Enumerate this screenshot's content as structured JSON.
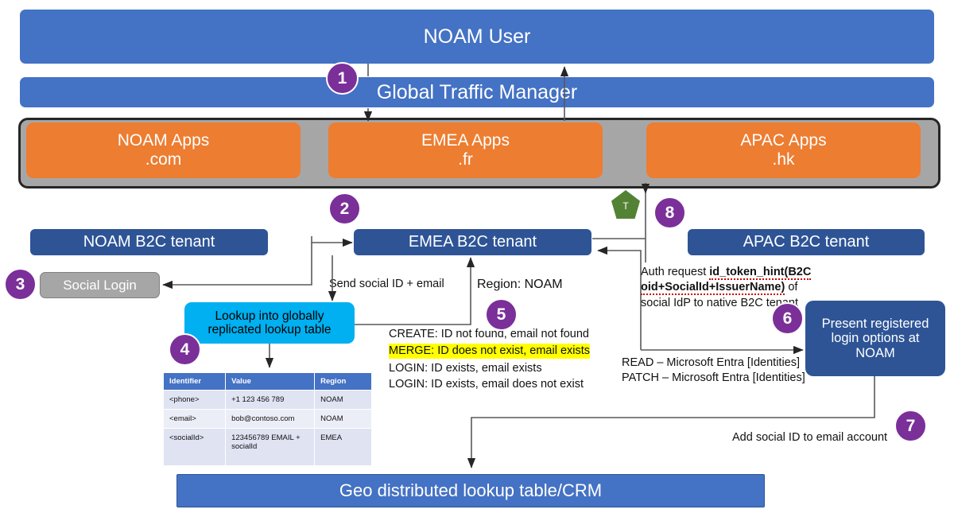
{
  "top": {
    "user": "NOAM User",
    "gtm": "Global Traffic Manager",
    "apps": [
      {
        "name": "NOAM Apps",
        "tld": ".com"
      },
      {
        "name": "EMEA Apps",
        "tld": ".fr"
      },
      {
        "name": "APAC Apps",
        "tld": ".hk"
      }
    ]
  },
  "tenants": {
    "noam": "NOAM B2C tenant",
    "emea": "EMEA B2C tenant",
    "apac": "APAC B2C tenant"
  },
  "nodes": {
    "social_login": "Social Login",
    "lookup": "Lookup into globally replicated lookup table",
    "present": "Present registered login options at NOAM",
    "geo": "Geo distributed lookup table/CRM"
  },
  "badges": [
    "1",
    "2",
    "3",
    "4",
    "5",
    "6",
    "7",
    "8"
  ],
  "pentagon": {
    "label": "T"
  },
  "labels": {
    "send_social": "Send social ID + email",
    "region_noam": "Region: NOAM",
    "create": "CREATE: ID not found, email not found",
    "merge": "MERGE: ID does not exist, email exists",
    "login_exists": "LOGIN: ID exists, email exists",
    "login_not_exists": "LOGIN: ID exists, email does not exist",
    "auth_request_1": "Auth request ",
    "auth_request_bold": "id_token_hint(B2C oid+SocialId+IssuerName)",
    "auth_request_2": " of social IdP to native B2C tenant",
    "read": "READ – Microsoft Entra [Identities]",
    "patch": "PATCH – Microsoft Entra [Identities]",
    "add_social": "Add social ID to email account"
  },
  "table": {
    "headers": [
      "Identifier",
      "Value",
      "Region"
    ],
    "rows": [
      [
        "<phone>",
        "+1 123 456 789",
        "NOAM"
      ],
      [
        "<email>",
        "bob@contoso.com",
        "NOAM"
      ],
      [
        "<socialId>",
        "123456789 EMAIL + socialId",
        "EMEA"
      ]
    ]
  },
  "colors": {
    "blue": "#4472c4",
    "navy": "#2e5496",
    "orange": "#ed7d31",
    "cyan": "#00b0f0",
    "purple": "#7b2f99",
    "green": "#548235",
    "grey": "#a6a6a6",
    "highlight": "#ffff00"
  }
}
